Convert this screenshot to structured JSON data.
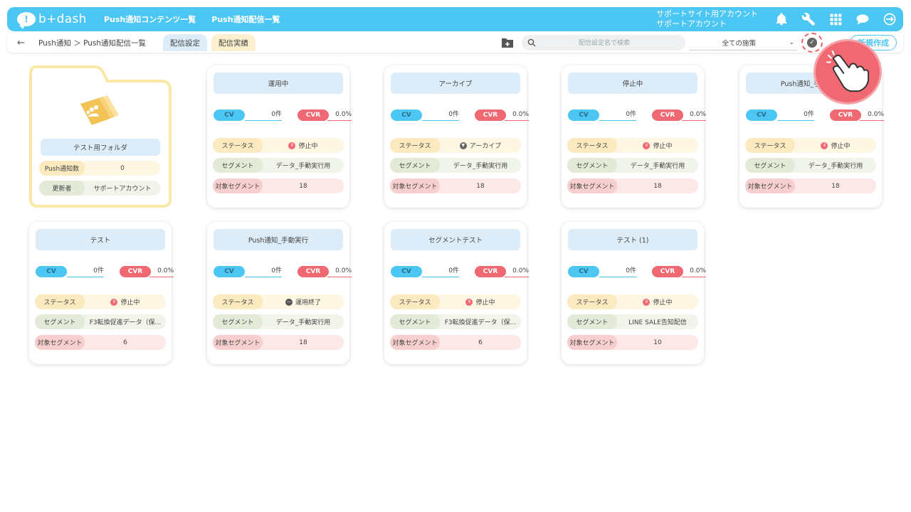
{
  "header": {
    "logo_mark": "!",
    "logo_text": "b+dash",
    "nav": [
      "Push通知コンテンツ一覧",
      "Push通知配信一覧"
    ],
    "account_line1": "サポートサイト用アカウント",
    "account_line2": "サポートアカウント",
    "icons": [
      "bell-icon",
      "wrench-icon",
      "apps-grid-icon",
      "chat-support-icon",
      "logout-icon"
    ]
  },
  "subbar": {
    "back": "←",
    "breadcrumb": "Push通知 ＞ Push通知配信一覧",
    "tabs": [
      "配信設定",
      "配信実績"
    ],
    "search_placeholder": "配信設定名で検索",
    "filter_value": "全ての施策",
    "filter_chevron": "⌄",
    "approve_mark": "✓",
    "new_button": "新規作成"
  },
  "folder": {
    "title": "テスト用フォルダ",
    "count_label": "Push通知数",
    "count_value": "0",
    "updater_label": "更新者",
    "updater_value": "サポートアカウント"
  },
  "labels": {
    "cv": "CV",
    "cvr": "CVR",
    "status": "ステータス",
    "segment": "セグメント",
    "target": "対象セグメント"
  },
  "cards": [
    {
      "title": "運用中",
      "cv": "0件",
      "cvr": "0.0%",
      "status": "停止中",
      "segment": "データ_手動実行用",
      "target": "18"
    },
    {
      "title": "アーカイブ",
      "cv": "0件",
      "cvr": "0.0%",
      "status": "アーカイブ",
      "segment": "データ_手動実行用",
      "target": "18"
    },
    {
      "title": "停止中",
      "cv": "0件",
      "cvr": "0.0%",
      "status": "停止中",
      "segment": "データ_手動実行用",
      "target": "18"
    },
    {
      "title": "Push通知_手動実行",
      "cv": "0件",
      "cvr": "0.0%",
      "status": "停止中",
      "segment": "データ_手動実行用",
      "target": "18"
    },
    {
      "title": "テスト",
      "cv": "0件",
      "cvr": "0.0%",
      "status": "停止中",
      "segment": "F3転換促進データ（保...",
      "target": "6"
    },
    {
      "title": "Push通知_手動実行",
      "cv": "0件",
      "cvr": "0.0%",
      "status": "運用終了",
      "segment": "データ_手動実行用",
      "target": "18"
    },
    {
      "title": "セグメントテスト",
      "cv": "0件",
      "cvr": "0.0%",
      "status": "停止中",
      "segment": "F3転換促進データ（保...",
      "target": "6"
    },
    {
      "title": "テスト (1)",
      "cv": "0件",
      "cvr": "0.0%",
      "status": "停止中",
      "segment": "LINE SALE告知配信",
      "target": "10"
    }
  ],
  "colors": {
    "brand": "#4cc6f3",
    "cvr": "#ef6872",
    "folder": "#fbe7a6"
  }
}
